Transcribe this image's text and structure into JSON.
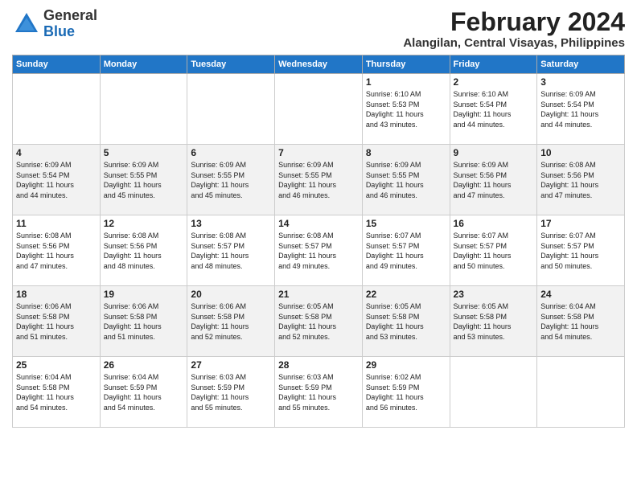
{
  "header": {
    "logo_general": "General",
    "logo_blue": "Blue",
    "title": "February 2024",
    "subtitle": "Alangilan, Central Visayas, Philippines"
  },
  "days_of_week": [
    "Sunday",
    "Monday",
    "Tuesday",
    "Wednesday",
    "Thursday",
    "Friday",
    "Saturday"
  ],
  "weeks": [
    [
      {
        "day": "",
        "info": ""
      },
      {
        "day": "",
        "info": ""
      },
      {
        "day": "",
        "info": ""
      },
      {
        "day": "",
        "info": ""
      },
      {
        "day": "1",
        "info": "Sunrise: 6:10 AM\nSunset: 5:53 PM\nDaylight: 11 hours\nand 43 minutes."
      },
      {
        "day": "2",
        "info": "Sunrise: 6:10 AM\nSunset: 5:54 PM\nDaylight: 11 hours\nand 44 minutes."
      },
      {
        "day": "3",
        "info": "Sunrise: 6:09 AM\nSunset: 5:54 PM\nDaylight: 11 hours\nand 44 minutes."
      }
    ],
    [
      {
        "day": "4",
        "info": "Sunrise: 6:09 AM\nSunset: 5:54 PM\nDaylight: 11 hours\nand 44 minutes."
      },
      {
        "day": "5",
        "info": "Sunrise: 6:09 AM\nSunset: 5:55 PM\nDaylight: 11 hours\nand 45 minutes."
      },
      {
        "day": "6",
        "info": "Sunrise: 6:09 AM\nSunset: 5:55 PM\nDaylight: 11 hours\nand 45 minutes."
      },
      {
        "day": "7",
        "info": "Sunrise: 6:09 AM\nSunset: 5:55 PM\nDaylight: 11 hours\nand 46 minutes."
      },
      {
        "day": "8",
        "info": "Sunrise: 6:09 AM\nSunset: 5:55 PM\nDaylight: 11 hours\nand 46 minutes."
      },
      {
        "day": "9",
        "info": "Sunrise: 6:09 AM\nSunset: 5:56 PM\nDaylight: 11 hours\nand 47 minutes."
      },
      {
        "day": "10",
        "info": "Sunrise: 6:08 AM\nSunset: 5:56 PM\nDaylight: 11 hours\nand 47 minutes."
      }
    ],
    [
      {
        "day": "11",
        "info": "Sunrise: 6:08 AM\nSunset: 5:56 PM\nDaylight: 11 hours\nand 47 minutes."
      },
      {
        "day": "12",
        "info": "Sunrise: 6:08 AM\nSunset: 5:56 PM\nDaylight: 11 hours\nand 48 minutes."
      },
      {
        "day": "13",
        "info": "Sunrise: 6:08 AM\nSunset: 5:57 PM\nDaylight: 11 hours\nand 48 minutes."
      },
      {
        "day": "14",
        "info": "Sunrise: 6:08 AM\nSunset: 5:57 PM\nDaylight: 11 hours\nand 49 minutes."
      },
      {
        "day": "15",
        "info": "Sunrise: 6:07 AM\nSunset: 5:57 PM\nDaylight: 11 hours\nand 49 minutes."
      },
      {
        "day": "16",
        "info": "Sunrise: 6:07 AM\nSunset: 5:57 PM\nDaylight: 11 hours\nand 50 minutes."
      },
      {
        "day": "17",
        "info": "Sunrise: 6:07 AM\nSunset: 5:57 PM\nDaylight: 11 hours\nand 50 minutes."
      }
    ],
    [
      {
        "day": "18",
        "info": "Sunrise: 6:06 AM\nSunset: 5:58 PM\nDaylight: 11 hours\nand 51 minutes."
      },
      {
        "day": "19",
        "info": "Sunrise: 6:06 AM\nSunset: 5:58 PM\nDaylight: 11 hours\nand 51 minutes."
      },
      {
        "day": "20",
        "info": "Sunrise: 6:06 AM\nSunset: 5:58 PM\nDaylight: 11 hours\nand 52 minutes."
      },
      {
        "day": "21",
        "info": "Sunrise: 6:05 AM\nSunset: 5:58 PM\nDaylight: 11 hours\nand 52 minutes."
      },
      {
        "day": "22",
        "info": "Sunrise: 6:05 AM\nSunset: 5:58 PM\nDaylight: 11 hours\nand 53 minutes."
      },
      {
        "day": "23",
        "info": "Sunrise: 6:05 AM\nSunset: 5:58 PM\nDaylight: 11 hours\nand 53 minutes."
      },
      {
        "day": "24",
        "info": "Sunrise: 6:04 AM\nSunset: 5:58 PM\nDaylight: 11 hours\nand 54 minutes."
      }
    ],
    [
      {
        "day": "25",
        "info": "Sunrise: 6:04 AM\nSunset: 5:58 PM\nDaylight: 11 hours\nand 54 minutes."
      },
      {
        "day": "26",
        "info": "Sunrise: 6:04 AM\nSunset: 5:59 PM\nDaylight: 11 hours\nand 54 minutes."
      },
      {
        "day": "27",
        "info": "Sunrise: 6:03 AM\nSunset: 5:59 PM\nDaylight: 11 hours\nand 55 minutes."
      },
      {
        "day": "28",
        "info": "Sunrise: 6:03 AM\nSunset: 5:59 PM\nDaylight: 11 hours\nand 55 minutes."
      },
      {
        "day": "29",
        "info": "Sunrise: 6:02 AM\nSunset: 5:59 PM\nDaylight: 11 hours\nand 56 minutes."
      },
      {
        "day": "",
        "info": ""
      },
      {
        "day": "",
        "info": ""
      }
    ]
  ]
}
